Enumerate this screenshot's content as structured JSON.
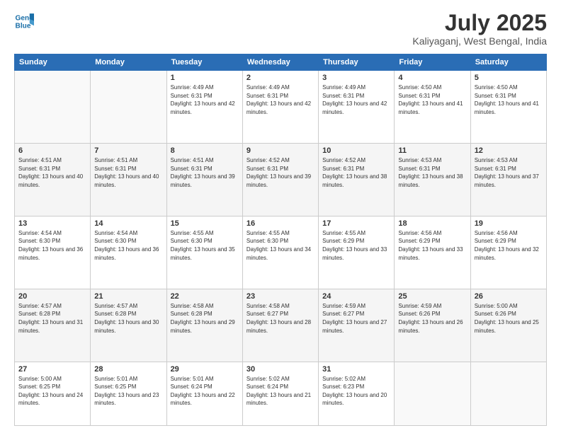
{
  "header": {
    "logo_line1": "General",
    "logo_line2": "Blue",
    "month_year": "July 2025",
    "location": "Kaliyaganj, West Bengal, India"
  },
  "weekdays": [
    "Sunday",
    "Monday",
    "Tuesday",
    "Wednesday",
    "Thursday",
    "Friday",
    "Saturday"
  ],
  "weeks": [
    [
      {
        "day": "",
        "empty": true
      },
      {
        "day": "",
        "empty": true
      },
      {
        "day": "1",
        "sunrise": "Sunrise: 4:49 AM",
        "sunset": "Sunset: 6:31 PM",
        "daylight": "Daylight: 13 hours and 42 minutes."
      },
      {
        "day": "2",
        "sunrise": "Sunrise: 4:49 AM",
        "sunset": "Sunset: 6:31 PM",
        "daylight": "Daylight: 13 hours and 42 minutes."
      },
      {
        "day": "3",
        "sunrise": "Sunrise: 4:49 AM",
        "sunset": "Sunset: 6:31 PM",
        "daylight": "Daylight: 13 hours and 42 minutes."
      },
      {
        "day": "4",
        "sunrise": "Sunrise: 4:50 AM",
        "sunset": "Sunset: 6:31 PM",
        "daylight": "Daylight: 13 hours and 41 minutes."
      },
      {
        "day": "5",
        "sunrise": "Sunrise: 4:50 AM",
        "sunset": "Sunset: 6:31 PM",
        "daylight": "Daylight: 13 hours and 41 minutes."
      }
    ],
    [
      {
        "day": "6",
        "sunrise": "Sunrise: 4:51 AM",
        "sunset": "Sunset: 6:31 PM",
        "daylight": "Daylight: 13 hours and 40 minutes."
      },
      {
        "day": "7",
        "sunrise": "Sunrise: 4:51 AM",
        "sunset": "Sunset: 6:31 PM",
        "daylight": "Daylight: 13 hours and 40 minutes."
      },
      {
        "day": "8",
        "sunrise": "Sunrise: 4:51 AM",
        "sunset": "Sunset: 6:31 PM",
        "daylight": "Daylight: 13 hours and 39 minutes."
      },
      {
        "day": "9",
        "sunrise": "Sunrise: 4:52 AM",
        "sunset": "Sunset: 6:31 PM",
        "daylight": "Daylight: 13 hours and 39 minutes."
      },
      {
        "day": "10",
        "sunrise": "Sunrise: 4:52 AM",
        "sunset": "Sunset: 6:31 PM",
        "daylight": "Daylight: 13 hours and 38 minutes."
      },
      {
        "day": "11",
        "sunrise": "Sunrise: 4:53 AM",
        "sunset": "Sunset: 6:31 PM",
        "daylight": "Daylight: 13 hours and 38 minutes."
      },
      {
        "day": "12",
        "sunrise": "Sunrise: 4:53 AM",
        "sunset": "Sunset: 6:31 PM",
        "daylight": "Daylight: 13 hours and 37 minutes."
      }
    ],
    [
      {
        "day": "13",
        "sunrise": "Sunrise: 4:54 AM",
        "sunset": "Sunset: 6:30 PM",
        "daylight": "Daylight: 13 hours and 36 minutes."
      },
      {
        "day": "14",
        "sunrise": "Sunrise: 4:54 AM",
        "sunset": "Sunset: 6:30 PM",
        "daylight": "Daylight: 13 hours and 36 minutes."
      },
      {
        "day": "15",
        "sunrise": "Sunrise: 4:55 AM",
        "sunset": "Sunset: 6:30 PM",
        "daylight": "Daylight: 13 hours and 35 minutes."
      },
      {
        "day": "16",
        "sunrise": "Sunrise: 4:55 AM",
        "sunset": "Sunset: 6:30 PM",
        "daylight": "Daylight: 13 hours and 34 minutes."
      },
      {
        "day": "17",
        "sunrise": "Sunrise: 4:55 AM",
        "sunset": "Sunset: 6:29 PM",
        "daylight": "Daylight: 13 hours and 33 minutes."
      },
      {
        "day": "18",
        "sunrise": "Sunrise: 4:56 AM",
        "sunset": "Sunset: 6:29 PM",
        "daylight": "Daylight: 13 hours and 33 minutes."
      },
      {
        "day": "19",
        "sunrise": "Sunrise: 4:56 AM",
        "sunset": "Sunset: 6:29 PM",
        "daylight": "Daylight: 13 hours and 32 minutes."
      }
    ],
    [
      {
        "day": "20",
        "sunrise": "Sunrise: 4:57 AM",
        "sunset": "Sunset: 6:28 PM",
        "daylight": "Daylight: 13 hours and 31 minutes."
      },
      {
        "day": "21",
        "sunrise": "Sunrise: 4:57 AM",
        "sunset": "Sunset: 6:28 PM",
        "daylight": "Daylight: 13 hours and 30 minutes."
      },
      {
        "day": "22",
        "sunrise": "Sunrise: 4:58 AM",
        "sunset": "Sunset: 6:28 PM",
        "daylight": "Daylight: 13 hours and 29 minutes."
      },
      {
        "day": "23",
        "sunrise": "Sunrise: 4:58 AM",
        "sunset": "Sunset: 6:27 PM",
        "daylight": "Daylight: 13 hours and 28 minutes."
      },
      {
        "day": "24",
        "sunrise": "Sunrise: 4:59 AM",
        "sunset": "Sunset: 6:27 PM",
        "daylight": "Daylight: 13 hours and 27 minutes."
      },
      {
        "day": "25",
        "sunrise": "Sunrise: 4:59 AM",
        "sunset": "Sunset: 6:26 PM",
        "daylight": "Daylight: 13 hours and 26 minutes."
      },
      {
        "day": "26",
        "sunrise": "Sunrise: 5:00 AM",
        "sunset": "Sunset: 6:26 PM",
        "daylight": "Daylight: 13 hours and 25 minutes."
      }
    ],
    [
      {
        "day": "27",
        "sunrise": "Sunrise: 5:00 AM",
        "sunset": "Sunset: 6:25 PM",
        "daylight": "Daylight: 13 hours and 24 minutes."
      },
      {
        "day": "28",
        "sunrise": "Sunrise: 5:01 AM",
        "sunset": "Sunset: 6:25 PM",
        "daylight": "Daylight: 13 hours and 23 minutes."
      },
      {
        "day": "29",
        "sunrise": "Sunrise: 5:01 AM",
        "sunset": "Sunset: 6:24 PM",
        "daylight": "Daylight: 13 hours and 22 minutes."
      },
      {
        "day": "30",
        "sunrise": "Sunrise: 5:02 AM",
        "sunset": "Sunset: 6:24 PM",
        "daylight": "Daylight: 13 hours and 21 minutes."
      },
      {
        "day": "31",
        "sunrise": "Sunrise: 5:02 AM",
        "sunset": "Sunset: 6:23 PM",
        "daylight": "Daylight: 13 hours and 20 minutes."
      },
      {
        "day": "",
        "empty": true
      },
      {
        "day": "",
        "empty": true
      }
    ]
  ]
}
